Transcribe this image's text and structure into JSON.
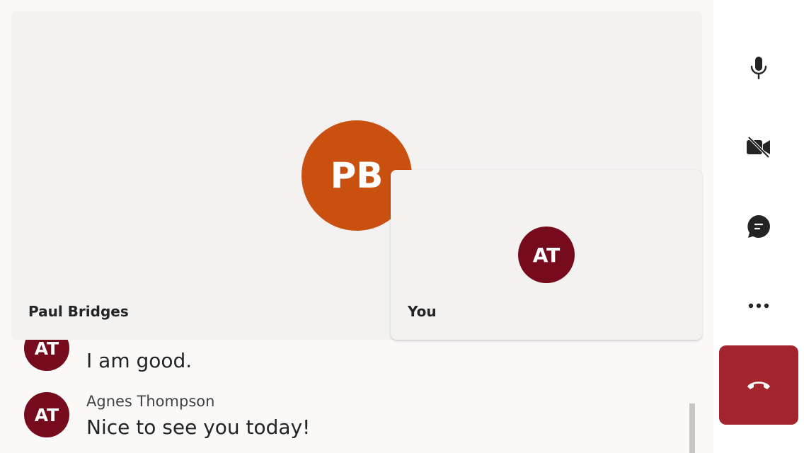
{
  "remote_tile": {
    "initials": "PB",
    "name": "Paul Bridges",
    "avatar_color": "#ca5010"
  },
  "self_tile": {
    "initials": "AT",
    "name": "You",
    "avatar_color": "#750b1c"
  },
  "chat": {
    "messages": [
      {
        "initials": "AT",
        "sender": "",
        "text": "I am good."
      },
      {
        "initials": "AT",
        "sender": "Agnes Thompson",
        "text": "Nice to see you today!"
      }
    ]
  },
  "controls": {
    "mic": "microphone-icon",
    "camera": "camera-off-icon",
    "chat": "chat-icon",
    "more": "more-icon",
    "hangup": "hang-up-icon",
    "hangup_color": "#a4262c"
  }
}
